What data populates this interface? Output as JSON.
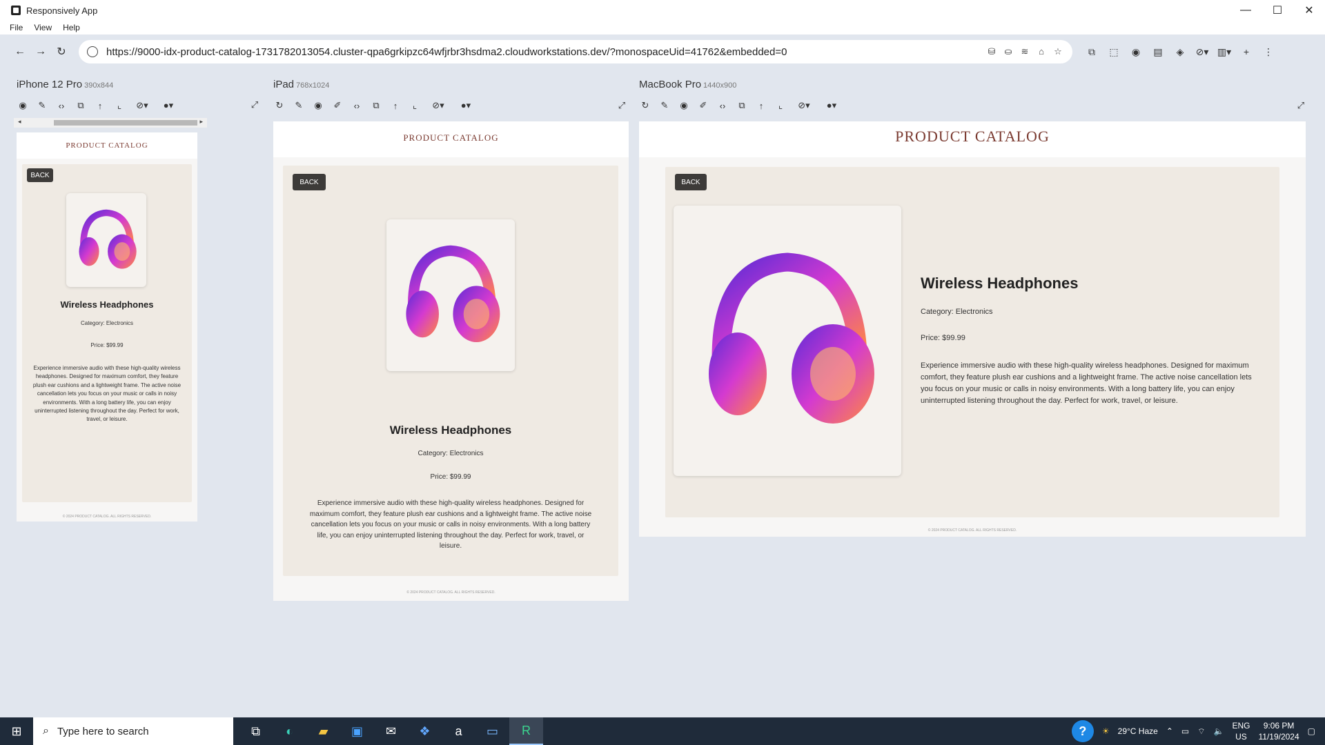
{
  "window": {
    "title": "Responsively App",
    "min": "—",
    "max": "☐",
    "close": "✕"
  },
  "menu": [
    "File",
    "View",
    "Help"
  ],
  "address": {
    "url": "https://9000-idx-product-catalog-1731782013054.cluster-qpa6grkipzc64wfjrbr3hsdma2.cloudworkstations.dev/?monospaceUid=41762&embedded=0"
  },
  "devices": [
    {
      "name": "iPhone 12 Pro",
      "size": "390x844"
    },
    {
      "name": "iPad",
      "size": "768x1024"
    },
    {
      "name": "MacBook Pro",
      "size": "1440x900"
    }
  ],
  "site": {
    "header": "PRODUCT CATALOG",
    "back": "BACK",
    "title": "Wireless Headphones",
    "category": "Category: Electronics",
    "price": "Price: $99.99",
    "description": "Experience immersive audio with these high-quality wireless headphones. Designed for maximum comfort, they feature plush ear cushions and a lightweight frame. The active noise cancellation lets you focus on your music or calls in noisy environments. With a long battery life, you can enjoy uninterrupted listening throughout the day. Perfect for work, travel, or leisure.",
    "footer": "© 2024 PRODUCT CATALOG. ALL RIGHTS RESERVED."
  },
  "taskbar": {
    "search_placeholder": "Type here to search",
    "weather": "29°C  Haze",
    "lang": "ENG",
    "region": "US",
    "time": "9:06 PM",
    "date": "11/19/2024"
  }
}
